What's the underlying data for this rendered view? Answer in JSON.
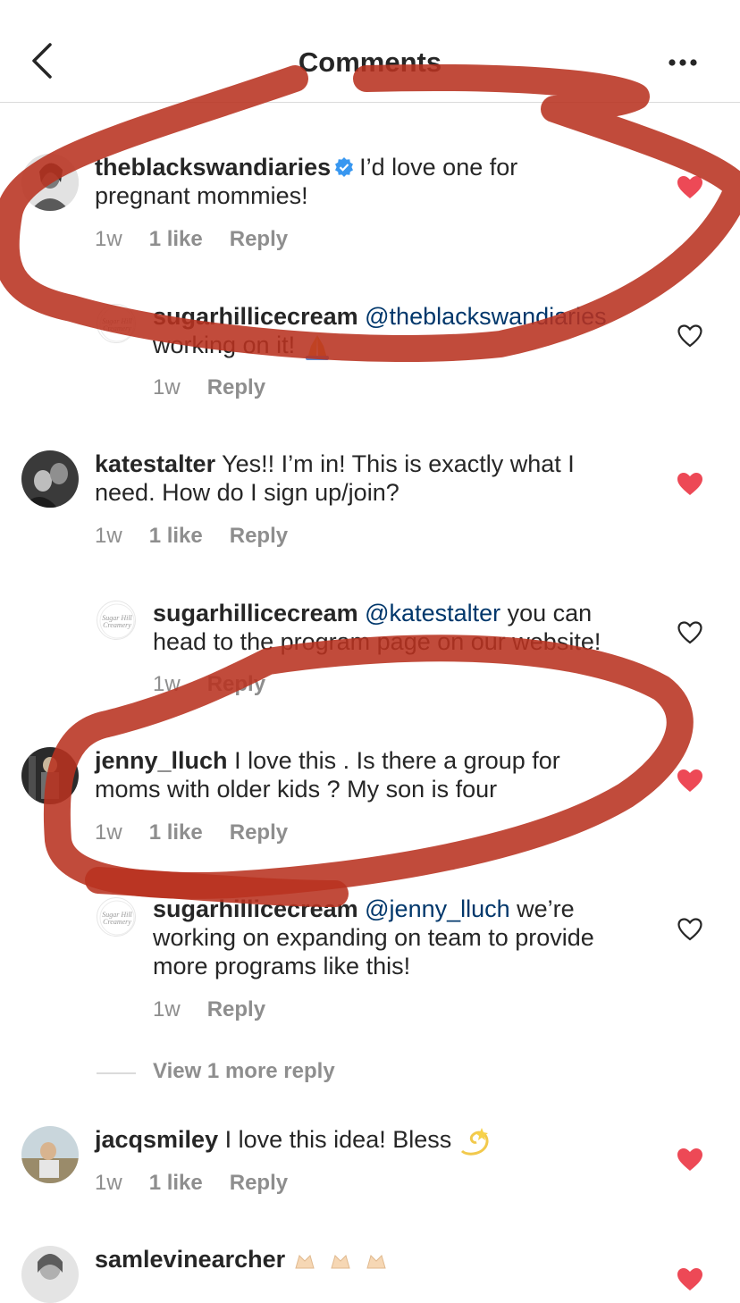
{
  "header": {
    "title": "Comments"
  },
  "comments": [
    {
      "user": "theblackswandiaries",
      "verified": true,
      "text_line1": "I’d love one for",
      "text_line2": "pregnant mommies!",
      "time": "1w",
      "likes": "1 like",
      "reply": "Reply",
      "liked": true
    },
    {
      "user": "sugarhillicecream",
      "mention": "@theblackswandiaries",
      "text_line2": "working on it!",
      "emoji": "folded-hands-emoji",
      "time": "1w",
      "reply": "Reply",
      "liked": false
    },
    {
      "user": "katestalter",
      "text_line1": "Yes!! I’m in! This is exactly what I",
      "text_line2": "need. How do I sign up/join?",
      "time": "1w",
      "likes": "1 like",
      "reply": "Reply",
      "liked": true
    },
    {
      "user": "sugarhillicecream",
      "mention": "@katestalter",
      "text_line1": "you can",
      "text_line2": "head to the program page on our website!",
      "time": "1w",
      "reply": "Reply",
      "liked": false
    },
    {
      "user": "jenny_lluch",
      "text_line1": "I love this . Is there a group for",
      "text_line2": "moms with older kids ? My son is four",
      "time": "1w",
      "likes": "1 like",
      "reply": "Reply",
      "liked": true
    },
    {
      "user": "sugarhillicecream",
      "mention": "@jenny_lluch",
      "text_line1": "we’re",
      "text_line2": "working on expanding on team to provide",
      "text_line3": "more programs like this!",
      "time": "1w",
      "reply": "Reply",
      "liked": false
    },
    {
      "user": "jacqsmiley",
      "text_line1": "I love this idea! Bless",
      "emoji": "dizzy-emoji",
      "time": "1w",
      "likes": "1 like",
      "reply": "Reply",
      "liked": true
    },
    {
      "user": "samlevinearcher",
      "emoji": "raising-hands-emoji",
      "liked": true
    }
  ],
  "view_more": "View 1 more reply",
  "brand_logo_text": "Sugar Hill Creamery",
  "colors": {
    "heart_red": "#ed4956",
    "mention_blue": "#00376b",
    "verified_blue": "#3897f0",
    "annotation_red": "#b83220"
  }
}
